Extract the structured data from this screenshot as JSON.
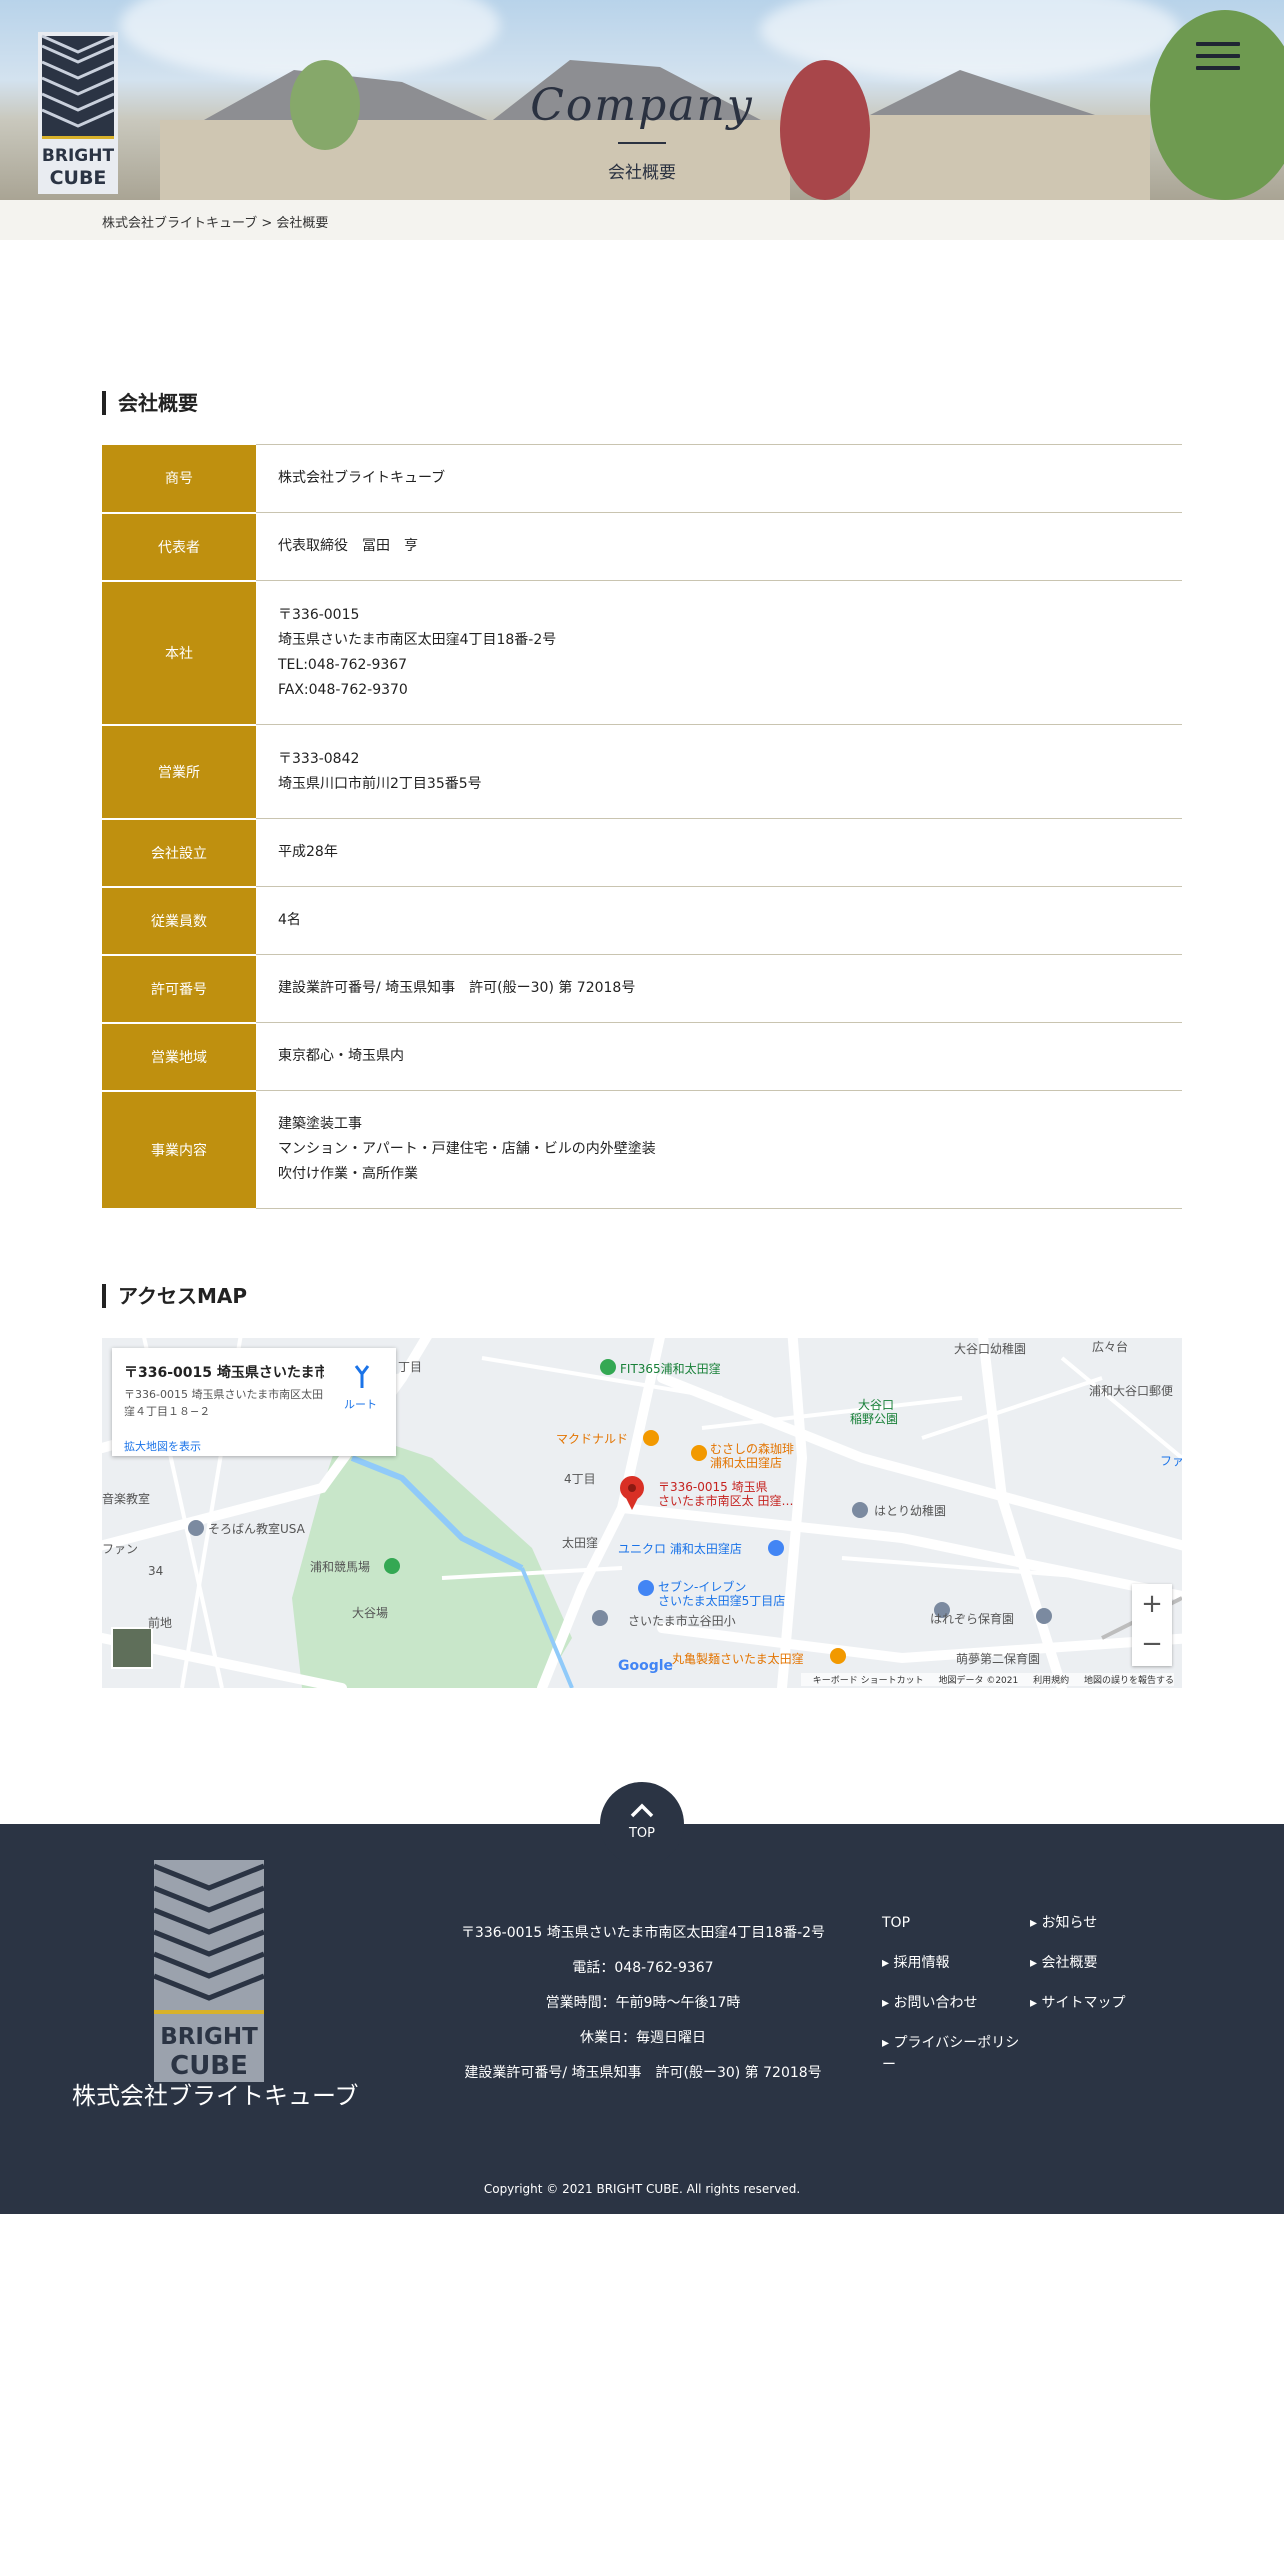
{
  "hero": {
    "title": "Company",
    "subtitle": "会社概要"
  },
  "logo": {
    "text_top": "BRIGHT",
    "text_bottom": "CUBE",
    "icon": "bright-cube-logo"
  },
  "menu": {
    "icon": "hamburger-menu-icon"
  },
  "breadcrumb": {
    "home": "株式会社ブライトキューブ",
    "separator": ">",
    "current": "会社概要"
  },
  "overview": {
    "heading": "会社概要",
    "rows": [
      {
        "label": "商号",
        "lines": [
          "株式会社ブライトキューブ"
        ]
      },
      {
        "label": "代表者",
        "lines": [
          "代表取締役　冨田　亨"
        ]
      },
      {
        "label": "本社",
        "lines": [
          "〒336-0015",
          "埼玉県さいたま市南区太田窪4丁目18番-2号",
          "TEL:048-762-9367",
          "FAX:048-762-9370"
        ]
      },
      {
        "label": "営業所",
        "lines": [
          "〒333-0842",
          "埼玉県川口市前川2丁目35番5号"
        ]
      },
      {
        "label": "会社設立",
        "lines": [
          "平成28年"
        ]
      },
      {
        "label": "従業員数",
        "lines": [
          "4名"
        ]
      },
      {
        "label": "許可番号",
        "lines": [
          "建設業許可番号/ 埼玉県知事　許可(般ー30) 第 72018号"
        ]
      },
      {
        "label": "営業地域",
        "lines": [
          "東京都心・埼玉県内"
        ]
      },
      {
        "label": "事業内容",
        "lines": [
          "建築塗装工事",
          "マンション・アパート・戸建住宅・店舗・ビルの内外壁塗装",
          "吹付け作業・高所作業"
        ]
      }
    ]
  },
  "access": {
    "heading": "アクセスMAP",
    "card": {
      "title": "〒336-0015 埼玉県さいたま市...",
      "address": "〒336-0015 埼玉県さいたま市南区太田窪４丁目１８−２",
      "larger_map": "拡大地図を表示",
      "route": "ルート"
    },
    "labels": {
      "fit": "FIT365浦和太田窪",
      "mcd": "マクドナルド",
      "cafe1": "むさしの森珈琲",
      "cafe2": "浦和太田窪店",
      "pin1": "〒336-0015 埼玉県",
      "pin2": "さいたま市南区太 田窪…",
      "park1": "大谷口",
      "park2": "稲野公園",
      "kinder1": "大谷口幼稚園",
      "urawa_oyaguchi": "浦和大谷口郵便",
      "hatori": "はとり幼稚園",
      "uniqlo": "ユニクロ 浦和太田窪店",
      "seven1": "セブン-イレブン",
      "seven2": "さいたま太田窪5丁目店",
      "school": "さいたま市立谷田小",
      "marugame": "丸亀製麺さいたま太田窪",
      "soroban": "そろばん教室USA",
      "urawa_keiba": "浦和競馬場",
      "taniba": "大谷場",
      "ohtakubo": "太田窪",
      "chome4": "4丁目",
      "maechi": "前地",
      "hareoza": "はれぞら保育園",
      "asahi": "萌夢第二保育園",
      "music": "音楽教室",
      "fan": "ファン",
      "fa": "ファ",
      "chome8": "丁目",
      "kodomo": "広々台",
      "route_num": "34",
      "google": "Google"
    },
    "zoom_in": "+",
    "zoom_out": "−",
    "footer_links": [
      "キーボード ショートカット",
      "地図データ ©2021",
      "利用規約",
      "地図の誤りを報告する"
    ]
  },
  "top_button": {
    "label": "TOP",
    "icon": "chevron-up-icon"
  },
  "footer": {
    "company": "株式会社ブライトキューブ",
    "info": [
      "〒336-0015 埼玉県さいたま市南区太田窪4丁目18番-2号",
      "電話：048-762-9367",
      "営業時間：午前9時～午後17時",
      "休業日：毎週日曜日",
      "建設業許可番号/ 埼玉県知事　許可(般ー30) 第 72018号"
    ],
    "nav": [
      {
        "label": "TOP"
      },
      {
        "label": "お知らせ"
      },
      {
        "label": "採用情報"
      },
      {
        "label": "会社概要"
      },
      {
        "label": "お問い合わせ"
      },
      {
        "label": "サイトマップ"
      },
      {
        "label": "プライバシーポリシー"
      }
    ],
    "copyright": "Copyright © 2021 BRIGHT CUBE. All rights reserved."
  },
  "colors": {
    "accent_gold": "#bf900f",
    "navy": "#2b3444",
    "breadcrumb_bg": "#f4f3ef"
  }
}
